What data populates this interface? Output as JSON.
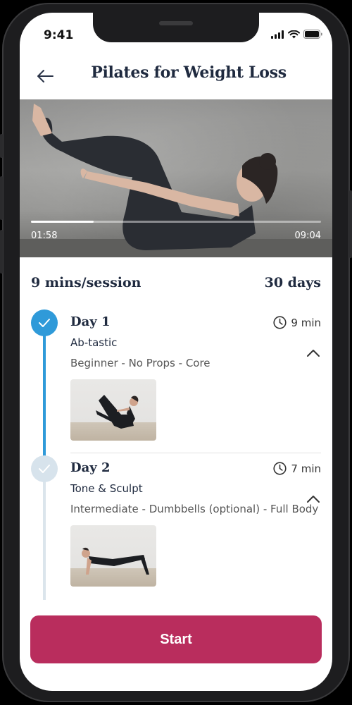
{
  "status_bar": {
    "time": "9:41"
  },
  "header": {
    "title": "Pilates for Weight Loss"
  },
  "video": {
    "current_time": "01:58",
    "total_time": "09:04",
    "progress": 0.217
  },
  "summary": {
    "session_length": "9 mins/session",
    "program_length": "30 days"
  },
  "days": [
    {
      "title": "Day 1",
      "duration": "9 min",
      "name": "Ab-tastic",
      "tags": "Beginner - No Props - Core",
      "completed": true
    },
    {
      "title": "Day 2",
      "duration": "7 min",
      "name": "Tone & Sculpt",
      "tags": "Intermediate - Dumbbells (optional) - Full Body",
      "completed": false
    }
  ],
  "start_button": {
    "label": "Start"
  },
  "colors": {
    "accent": "#b92d5d",
    "timeline_active": "#2f9ad9",
    "timeline_inactive": "#d7e3ec",
    "title_text": "#1f2a3f"
  },
  "icons": [
    "back-arrow-icon",
    "signal-icon",
    "wifi-icon",
    "battery-icon",
    "checkmark-icon",
    "clock-icon",
    "chevron-up-icon"
  ]
}
